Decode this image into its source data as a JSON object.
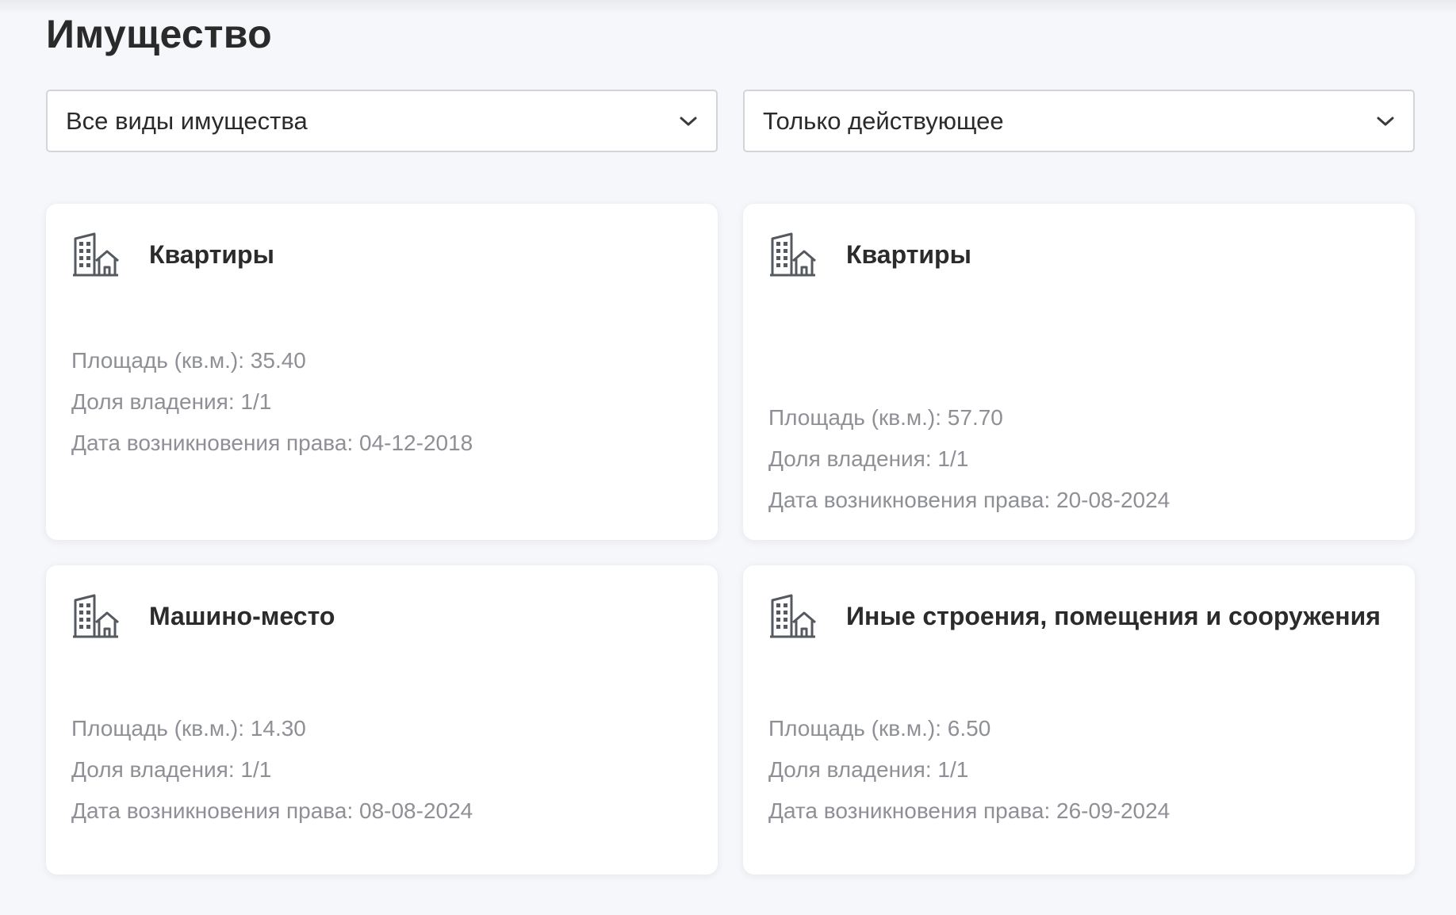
{
  "page": {
    "title": "Имущество"
  },
  "filters": {
    "type_select": {
      "value": "Все виды имущества",
      "icon": "chevron-down-icon"
    },
    "status_select": {
      "value": "Только действующее",
      "icon": "chevron-down-icon"
    }
  },
  "colors": {
    "background": "#f6f7fb",
    "card": "#ffffff",
    "title_text": "#2b2b2b",
    "detail_text": "#8e9096",
    "icon": "#555a61",
    "border": "#d3d5da"
  },
  "cards": [
    {
      "icon": "building-house-icon",
      "title": "Квартиры",
      "area": "Площадь (кв.м.): 35.40",
      "share": "Доля владения: 1/1",
      "date": "Дата возникновения права: 04-12-2018"
    },
    {
      "icon": "building-house-icon",
      "title": "Квартиры",
      "area": "Площадь (кв.м.): 57.70",
      "share": "Доля владения: 1/1",
      "date": "Дата возникновения права: 20-08-2024"
    },
    {
      "icon": "building-house-icon",
      "title": "Машино-место",
      "area": "Площадь (кв.м.): 14.30",
      "share": "Доля владения: 1/1",
      "date": "Дата возникновения права: 08-08-2024"
    },
    {
      "icon": "building-house-icon",
      "title": "Иные строения, помещения и сооружения",
      "area": "Площадь (кв.м.): 6.50",
      "share": "Доля владения: 1/1",
      "date": "Дата возникновения права: 26-09-2024"
    }
  ]
}
